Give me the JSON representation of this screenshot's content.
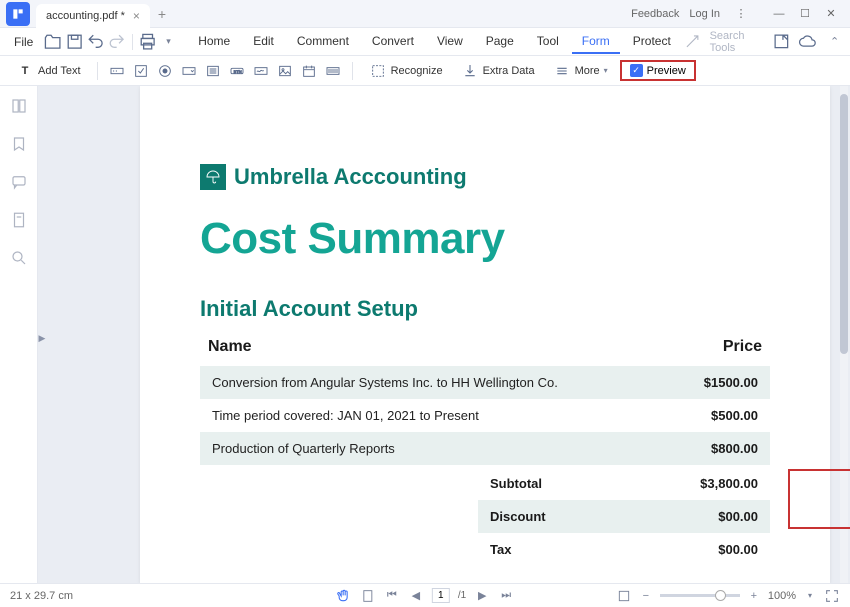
{
  "titlebar": {
    "filename": "accounting.pdf *",
    "feedback": "Feedback",
    "login": "Log In"
  },
  "menubar": {
    "file": "File",
    "tabs": [
      "Home",
      "Edit",
      "Comment",
      "Convert",
      "View",
      "Page",
      "Tool",
      "Form",
      "Protect"
    ],
    "active_tab": "Form",
    "search_placeholder": "Search Tools"
  },
  "toolbar": {
    "add_text": "Add Text",
    "recognize": "Recognize",
    "extra_data": "Extra Data",
    "more": "More",
    "preview": "Preview"
  },
  "document": {
    "brand": "Umbrella Acccounting",
    "title": "Cost Summary",
    "section": "Initial Account Setup",
    "columns": {
      "name": "Name",
      "price": "Price"
    },
    "rows": [
      {
        "name": "Conversion from Angular Systems Inc. to HH Wellington Co.",
        "price": "$1500.00",
        "hl": true
      },
      {
        "name": "Time period covered: JAN 01, 2021 to Present",
        "price": "$500.00",
        "hl": true
      },
      {
        "name": "Production of Quarterly Reports",
        "price": "$800.00",
        "hl": false
      }
    ],
    "summary": [
      {
        "label": "Subtotal",
        "value": "$3,800.00",
        "shaded": false
      },
      {
        "label": "Discount",
        "value": "$00.00",
        "shaded": true
      },
      {
        "label": "Tax",
        "value": "$00.00",
        "shaded": false
      }
    ]
  },
  "statusbar": {
    "dims": "21 x 29.7 cm",
    "page_cur": "1",
    "page_total": "/1",
    "zoom": "100%"
  }
}
